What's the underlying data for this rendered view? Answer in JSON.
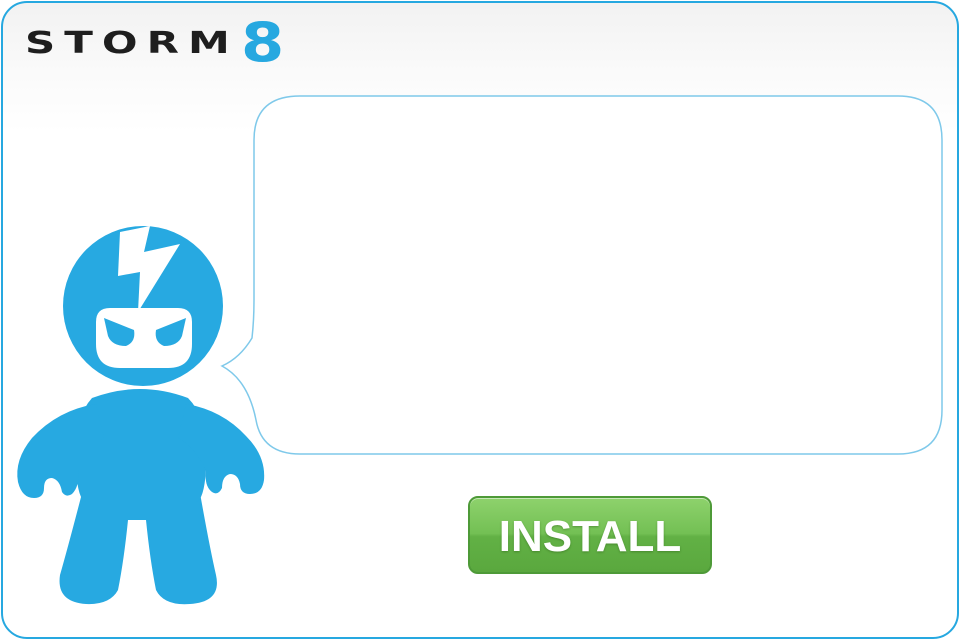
{
  "logo": {
    "word": "storm",
    "number": "8"
  },
  "speech_bubble": {
    "text": ""
  },
  "install_button": {
    "label": "INSTALL"
  },
  "colors": {
    "brand_blue": "#26a8e0",
    "button_green": "#6cbb4f",
    "logo_dark": "#1e1e1e"
  },
  "icons": {
    "mascot": "storm8-mascot-illustration",
    "lightning": "lightning-bolt-icon"
  }
}
